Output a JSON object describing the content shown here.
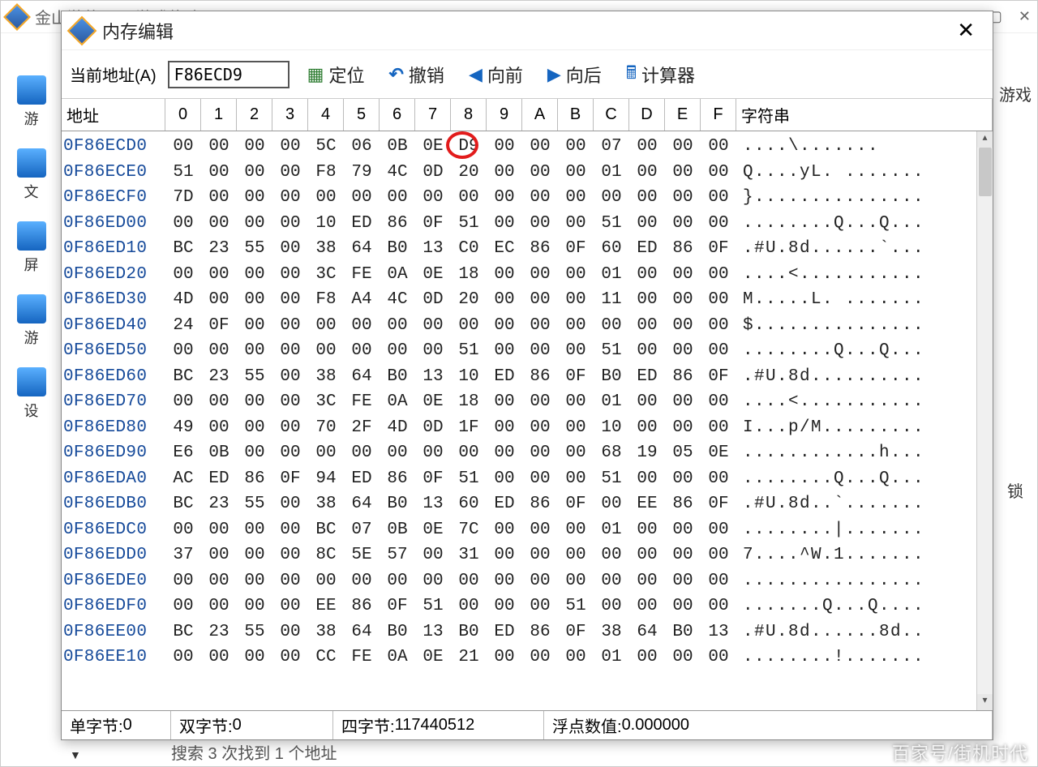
{
  "outer": {
    "title": "金山游侠V — 游戏修改",
    "sidebar_labels": [
      "游",
      "文",
      "屏",
      "游",
      "设"
    ],
    "right_panel_top": "游戏",
    "right_panel_bottom": "锁",
    "search_result": "搜索 3 次找到 1 个地址"
  },
  "dialog": {
    "title": "内存编辑",
    "addr_label": "当前地址(A)",
    "addr_value": "F86ECD9",
    "toolbar": {
      "locate": "定位",
      "undo": "撤销",
      "prev": "向前",
      "next": "向后",
      "calc": "计算器"
    },
    "headers": {
      "addr": "地址",
      "str": "字符串",
      "cols": [
        "0",
        "1",
        "2",
        "3",
        "4",
        "5",
        "6",
        "7",
        "8",
        "9",
        "A",
        "B",
        "C",
        "D",
        "E",
        "F"
      ]
    },
    "rows": [
      {
        "a": "0F86ECD0",
        "h": [
          "00",
          "00",
          "00",
          "00",
          "5C",
          "06",
          "0B",
          "0E",
          "D9",
          "00",
          "00",
          "00",
          "07",
          "00",
          "00",
          "00"
        ],
        "s": "....\\......."
      },
      {
        "a": "0F86ECE0",
        "h": [
          "51",
          "00",
          "00",
          "00",
          "F8",
          "79",
          "4C",
          "0D",
          "20",
          "00",
          "00",
          "00",
          "01",
          "00",
          "00",
          "00"
        ],
        "s": "Q....yL. ......."
      },
      {
        "a": "0F86ECF0",
        "h": [
          "7D",
          "00",
          "00",
          "00",
          "00",
          "00",
          "00",
          "00",
          "00",
          "00",
          "00",
          "00",
          "00",
          "00",
          "00",
          "00"
        ],
        "s": "}..............."
      },
      {
        "a": "0F86ED00",
        "h": [
          "00",
          "00",
          "00",
          "00",
          "10",
          "ED",
          "86",
          "0F",
          "51",
          "00",
          "00",
          "00",
          "51",
          "00",
          "00",
          "00"
        ],
        "s": "........Q...Q..."
      },
      {
        "a": "0F86ED10",
        "h": [
          "BC",
          "23",
          "55",
          "00",
          "38",
          "64",
          "B0",
          "13",
          "C0",
          "EC",
          "86",
          "0F",
          "60",
          "ED",
          "86",
          "0F"
        ],
        "s": ".#U.8d......`..."
      },
      {
        "a": "0F86ED20",
        "h": [
          "00",
          "00",
          "00",
          "00",
          "3C",
          "FE",
          "0A",
          "0E",
          "18",
          "00",
          "00",
          "00",
          "01",
          "00",
          "00",
          "00"
        ],
        "s": "....<..........."
      },
      {
        "a": "0F86ED30",
        "h": [
          "4D",
          "00",
          "00",
          "00",
          "F8",
          "A4",
          "4C",
          "0D",
          "20",
          "00",
          "00",
          "00",
          "11",
          "00",
          "00",
          "00"
        ],
        "s": "M.....L. ......."
      },
      {
        "a": "0F86ED40",
        "h": [
          "24",
          "0F",
          "00",
          "00",
          "00",
          "00",
          "00",
          "00",
          "00",
          "00",
          "00",
          "00",
          "00",
          "00",
          "00",
          "00"
        ],
        "s": "$..............."
      },
      {
        "a": "0F86ED50",
        "h": [
          "00",
          "00",
          "00",
          "00",
          "00",
          "00",
          "00",
          "00",
          "51",
          "00",
          "00",
          "00",
          "51",
          "00",
          "00",
          "00"
        ],
        "s": "........Q...Q..."
      },
      {
        "a": "0F86ED60",
        "h": [
          "BC",
          "23",
          "55",
          "00",
          "38",
          "64",
          "B0",
          "13",
          "10",
          "ED",
          "86",
          "0F",
          "B0",
          "ED",
          "86",
          "0F"
        ],
        "s": ".#U.8d.........."
      },
      {
        "a": "0F86ED70",
        "h": [
          "00",
          "00",
          "00",
          "00",
          "3C",
          "FE",
          "0A",
          "0E",
          "18",
          "00",
          "00",
          "00",
          "01",
          "00",
          "00",
          "00"
        ],
        "s": "....<..........."
      },
      {
        "a": "0F86ED80",
        "h": [
          "49",
          "00",
          "00",
          "00",
          "70",
          "2F",
          "4D",
          "0D",
          "1F",
          "00",
          "00",
          "00",
          "10",
          "00",
          "00",
          "00"
        ],
        "s": "I...p/M........."
      },
      {
        "a": "0F86ED90",
        "h": [
          "E6",
          "0B",
          "00",
          "00",
          "00",
          "00",
          "00",
          "00",
          "00",
          "00",
          "00",
          "00",
          "68",
          "19",
          "05",
          "0E"
        ],
        "s": "............h..."
      },
      {
        "a": "0F86EDA0",
        "h": [
          "AC",
          "ED",
          "86",
          "0F",
          "94",
          "ED",
          "86",
          "0F",
          "51",
          "00",
          "00",
          "00",
          "51",
          "00",
          "00",
          "00"
        ],
        "s": "........Q...Q..."
      },
      {
        "a": "0F86EDB0",
        "h": [
          "BC",
          "23",
          "55",
          "00",
          "38",
          "64",
          "B0",
          "13",
          "60",
          "ED",
          "86",
          "0F",
          "00",
          "EE",
          "86",
          "0F"
        ],
        "s": ".#U.8d..`......."
      },
      {
        "a": "0F86EDC0",
        "h": [
          "00",
          "00",
          "00",
          "00",
          "BC",
          "07",
          "0B",
          "0E",
          "7C",
          "00",
          "00",
          "00",
          "01",
          "00",
          "00",
          "00"
        ],
        "s": "........|......."
      },
      {
        "a": "0F86EDD0",
        "h": [
          "37",
          "00",
          "00",
          "00",
          "8C",
          "5E",
          "57",
          "00",
          "31",
          "00",
          "00",
          "00",
          "00",
          "00",
          "00",
          "00"
        ],
        "s": "7....^W.1......."
      },
      {
        "a": "0F86EDE0",
        "h": [
          "00",
          "00",
          "00",
          "00",
          "00",
          "00",
          "00",
          "00",
          "00",
          "00",
          "00",
          "00",
          "00",
          "00",
          "00",
          "00"
        ],
        "s": "................"
      },
      {
        "a": "0F86EDF0",
        "h": [
          "00",
          "00",
          "00",
          "00",
          "EE",
          "86",
          "0F",
          "51",
          "00",
          "00",
          "00",
          "51",
          "00",
          "00",
          "00",
          "00"
        ],
        "s": ".......Q...Q...."
      },
      {
        "a": "0F86EE00",
        "h": [
          "BC",
          "23",
          "55",
          "00",
          "38",
          "64",
          "B0",
          "13",
          "B0",
          "ED",
          "86",
          "0F",
          "38",
          "64",
          "B0",
          "13"
        ],
        "s": ".#U.8d......8d.."
      },
      {
        "a": "0F86EE10",
        "h": [
          "00",
          "00",
          "00",
          "00",
          "CC",
          "FE",
          "0A",
          "0E",
          "21",
          "00",
          "00",
          "00",
          "01",
          "00",
          "00",
          "00"
        ],
        "s": "........!......."
      }
    ],
    "highlight": {
      "row": 0,
      "col": 8
    },
    "status": {
      "byte1_label": "单字节:",
      "byte1_val": "0",
      "byte2_label": "双字节:",
      "byte2_val": "0",
      "byte4_label": "四字节:",
      "byte4_val": "117440512",
      "float_label": "浮点数值:",
      "float_val": "0.000000"
    }
  },
  "watermark": "百家号/街机时代"
}
